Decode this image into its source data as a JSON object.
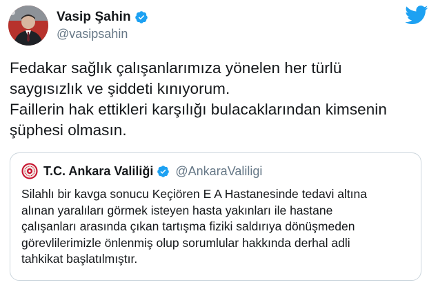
{
  "author": {
    "display_name": "Vasip Şahin",
    "handle": "@vasipsahin",
    "avatar_icon": "profile-photo",
    "verified_icon": "verified-badge-icon"
  },
  "brand": {
    "logo_icon": "twitter-bird-icon",
    "accent_color": "#1da1f2"
  },
  "tweet": {
    "lines": [
      "Fedakar sağlık çalışanlarımıza yönelen her türlü",
      "saygısızlık ve şiddeti kınıyorum.",
      "Faillerin hak ettikleri karşılığı bulacaklarından kimsenin",
      "şüphesi olmasın."
    ]
  },
  "quoted_tweet": {
    "display_name": "T.C. Ankara Valiliği",
    "handle": "@AnkaraValiligi",
    "avatar_icon": "ankara-governorship-seal",
    "verified_icon": "verified-badge-icon",
    "lines": [
      "Silahlı bir kavga sonucu Keçiören E A Hastanesinde tedavi altına",
      "alınan yaralıları görmek isteyen hasta yakınları ile hastane",
      "çalışanları arasında çıkan tartışma fiziki saldırıya dönüşmeden",
      "görevlilerimizle önlenmiş olup sorumlular hakkında derhal adli",
      "tahkikat başlatılmıştır."
    ]
  }
}
